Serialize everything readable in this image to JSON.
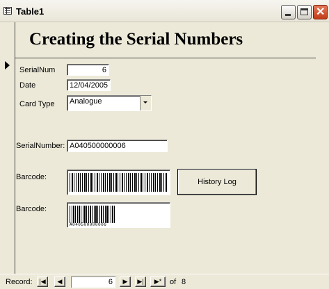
{
  "window": {
    "title": "Table1"
  },
  "form": {
    "heading": "Creating the Serial Numbers",
    "serialnum_label": "SerialNum",
    "serialnum_value": "6",
    "date_label": "Date",
    "date_value": "12/04/2005",
    "cardtype_label": "Card Type",
    "cardtype_value": "Analogue",
    "serialnumber_label": "SerialNumber:",
    "serialnumber_value": "A040500000006",
    "barcode1_label": "Barcode:",
    "barcode2_label": "Barcode:",
    "barcode2_digits": "A040500000006",
    "history_button": "History Log"
  },
  "navigation": {
    "record_label": "Record:",
    "first_icon": "first-record-icon",
    "prev_icon": "previous-record-icon",
    "next_icon": "next-record-icon",
    "last_icon": "last-record-icon",
    "new_icon": "new-record-icon",
    "current": "6",
    "of_label": "of",
    "total": "8"
  },
  "colors": {
    "face": "#ece9d8",
    "close": "#c23b17"
  }
}
